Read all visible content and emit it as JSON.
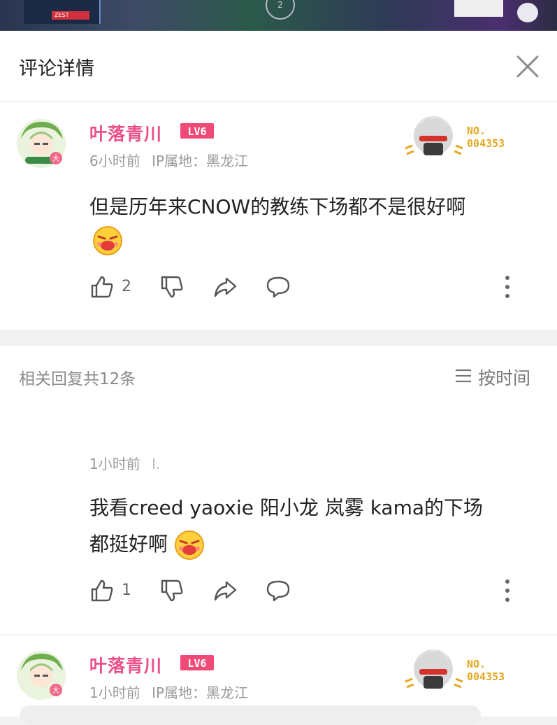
{
  "header": {
    "title": "评论详情"
  },
  "main_comment": {
    "username": "叶落青川",
    "level_badge": "LV6",
    "time": "6小时前",
    "ip_label": "IP属地：黑龙江",
    "text": "但是历年来CNOW的教练下场都不是很好啊",
    "like_count": "2",
    "medal_no_label": "NO.",
    "medal_no": "004353"
  },
  "replies_header": {
    "count_text": "相关回复共12条",
    "sort_label": "按时间"
  },
  "reply": {
    "time": "1小时前",
    "ip_partial": "I.",
    "text_line1": "我看creed yaoxie 阳小龙 岚雾 kama的下场",
    "text_line2": "都挺好啊",
    "like_count": "1"
  },
  "next_comment": {
    "username": "叶落青川",
    "level_badge": "LV6",
    "time": "1小时前",
    "ip_label": "IP属地：黑龙江",
    "medal_no_label": "NO.",
    "medal_no": "004353"
  },
  "video": {
    "hud_text": "ZEST",
    "center_number": "2"
  },
  "icons": [
    "close-icon",
    "thumbs-up-icon",
    "thumbs-down-icon",
    "share-icon",
    "comment-icon",
    "more-vertical-icon",
    "sort-list-icon",
    "avatar",
    "medal"
  ],
  "colors": {
    "username": "#eb4f8a",
    "level_badge": "#f04a76",
    "medal": "#e4a721",
    "meta_text": "#999999"
  }
}
